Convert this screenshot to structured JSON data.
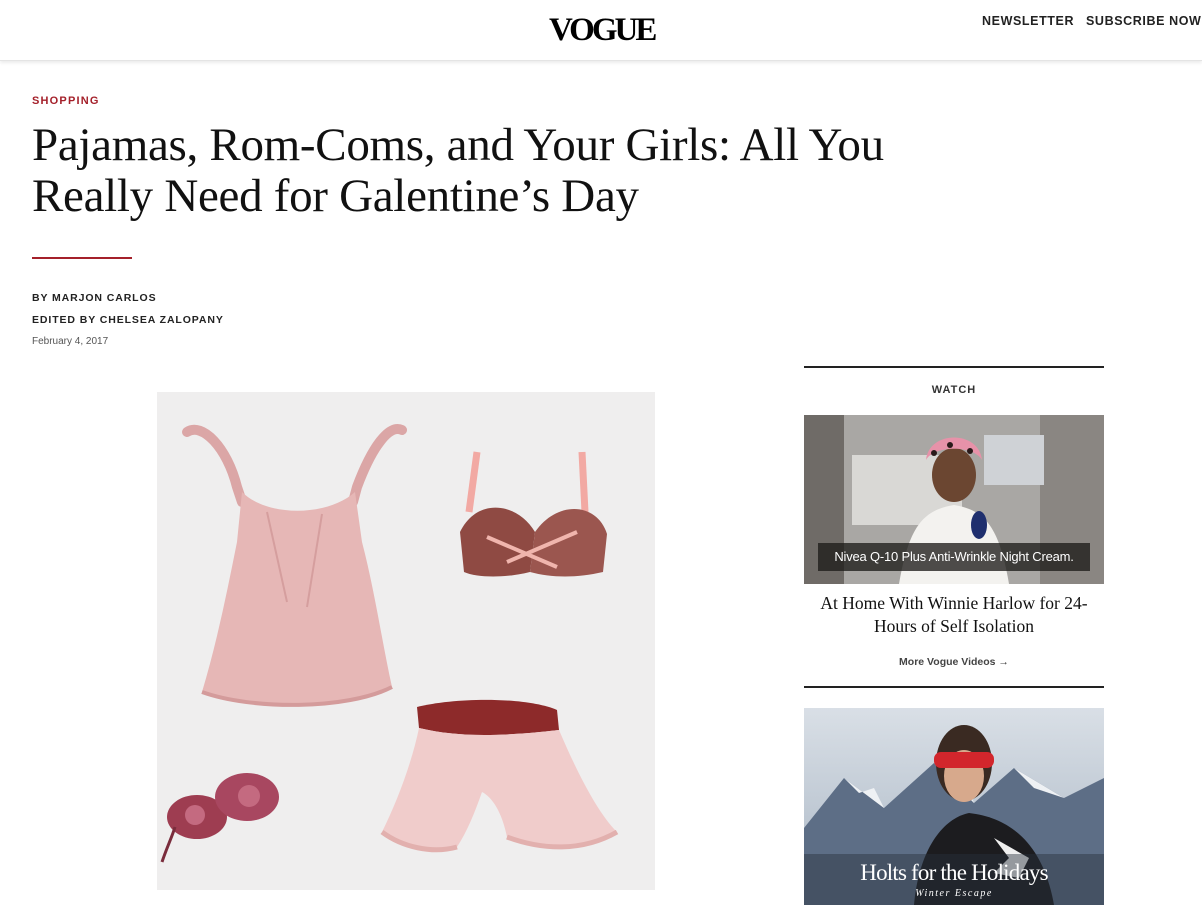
{
  "header": {
    "logo": "VOGUE",
    "newsletter": "NEWSLETTER",
    "subscribe": "SUBSCRIBE NOW"
  },
  "article": {
    "section": "SHOPPING",
    "headline": "Pajamas, Rom-Coms, and Your Girls: All You Really Need for Galentine’s Day",
    "byline_prefix": "BY ",
    "author": "MARJON CARLOS",
    "editor_prefix": "EDITED BY ",
    "editor": "CHELSEA ZALOPANY",
    "date": "February 4, 2017"
  },
  "sidebar": {
    "watch_label": "WATCH",
    "video_caption": "Nivea Q-10 Plus Anti-Wrinkle Night Cream.",
    "video_title": "At Home With Winnie Harlow for 24-Hours of Self Isolation",
    "more_videos": "More Vogue Videos →",
    "ad_title": "Holts for the Holidays",
    "ad_subtitle": "Winter Escape"
  },
  "colors": {
    "accent_red": "#a4202a",
    "pajama_pink": "#e6b7b6",
    "velvet_red": "#8d2a2a"
  }
}
